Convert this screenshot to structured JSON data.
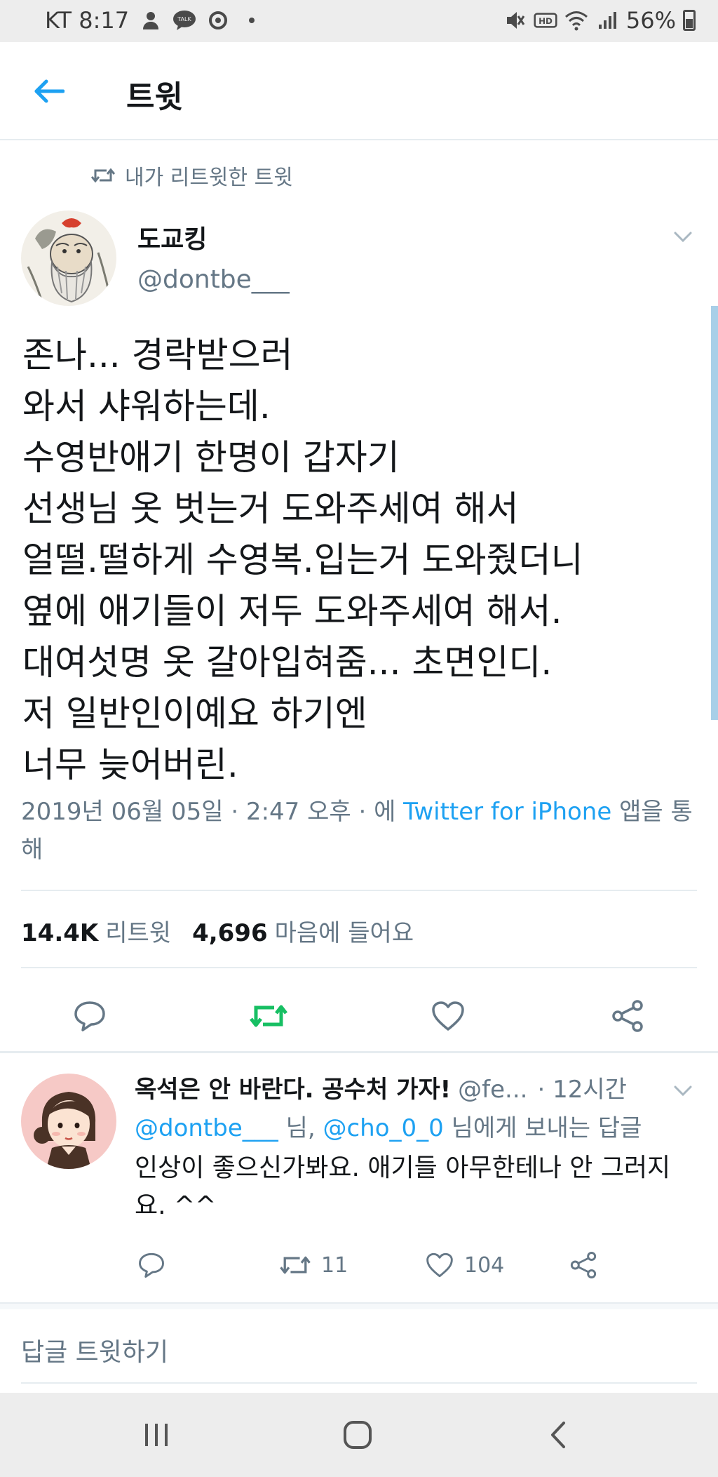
{
  "status_bar": {
    "carrier_time": "KT 8:17",
    "battery": "56%",
    "icons": [
      "person-icon",
      "talk-icon",
      "sync-icon",
      "dot-icon",
      "mute-icon",
      "hd-icon",
      "wifi-icon",
      "signal-icon",
      "battery-icon"
    ],
    "talk_label": "TALK",
    "hd_label": "HD"
  },
  "header": {
    "title": "트윗"
  },
  "retweet_context": {
    "label": "내가 리트윗한 트윗"
  },
  "tweet": {
    "author_name": "도교킹",
    "author_handle": "@dontbe___",
    "body": "존나... 경락받으러\n와서 샤워하는데.\n수영반애기 한명이 갑자기\n선생님 옷 벗는거 도와주세여 해서\n얼떨.떨하게 수영복.입는거 도와줬더니\n옆에 애기들이 저두 도와주세여 해서.\n대여섯명 옷 갈아입혀줌... 초면인디.\n저 일반인이예요 하기엔\n너무 늦어버린.",
    "meta_prefix": "2019년 06월 05일 · 2:47 오후 · 에 ",
    "meta_source": "Twitter for iPhone",
    "meta_suffix": " 앱을 통해",
    "retweet_count": "14.4K",
    "retweet_label": "리트윗",
    "like_count": "4,696",
    "like_label": "마음에 들어요"
  },
  "reply": {
    "author_name": "옥석은 안 바란다. 공수처 가자!",
    "author_handle": "@fe...",
    "time": "· 12시간",
    "replying_mention_1": "@dontbe___",
    "replying_mid": " 님, ",
    "replying_mention_2": "@cho_0_0",
    "replying_suffix": " 님에게 보내는 답글",
    "text": "인상이 좋으신가봐요. 애기들 아무한테나 안 그러지요. ^^",
    "retweet_count": "11",
    "like_count": "104"
  },
  "compose": {
    "placeholder": "답글 트윗하기"
  },
  "colors": {
    "accent": "#1da1f2",
    "retweet_active": "#17bf63",
    "secondary_text": "#657786",
    "divider": "#e6ecf0"
  }
}
